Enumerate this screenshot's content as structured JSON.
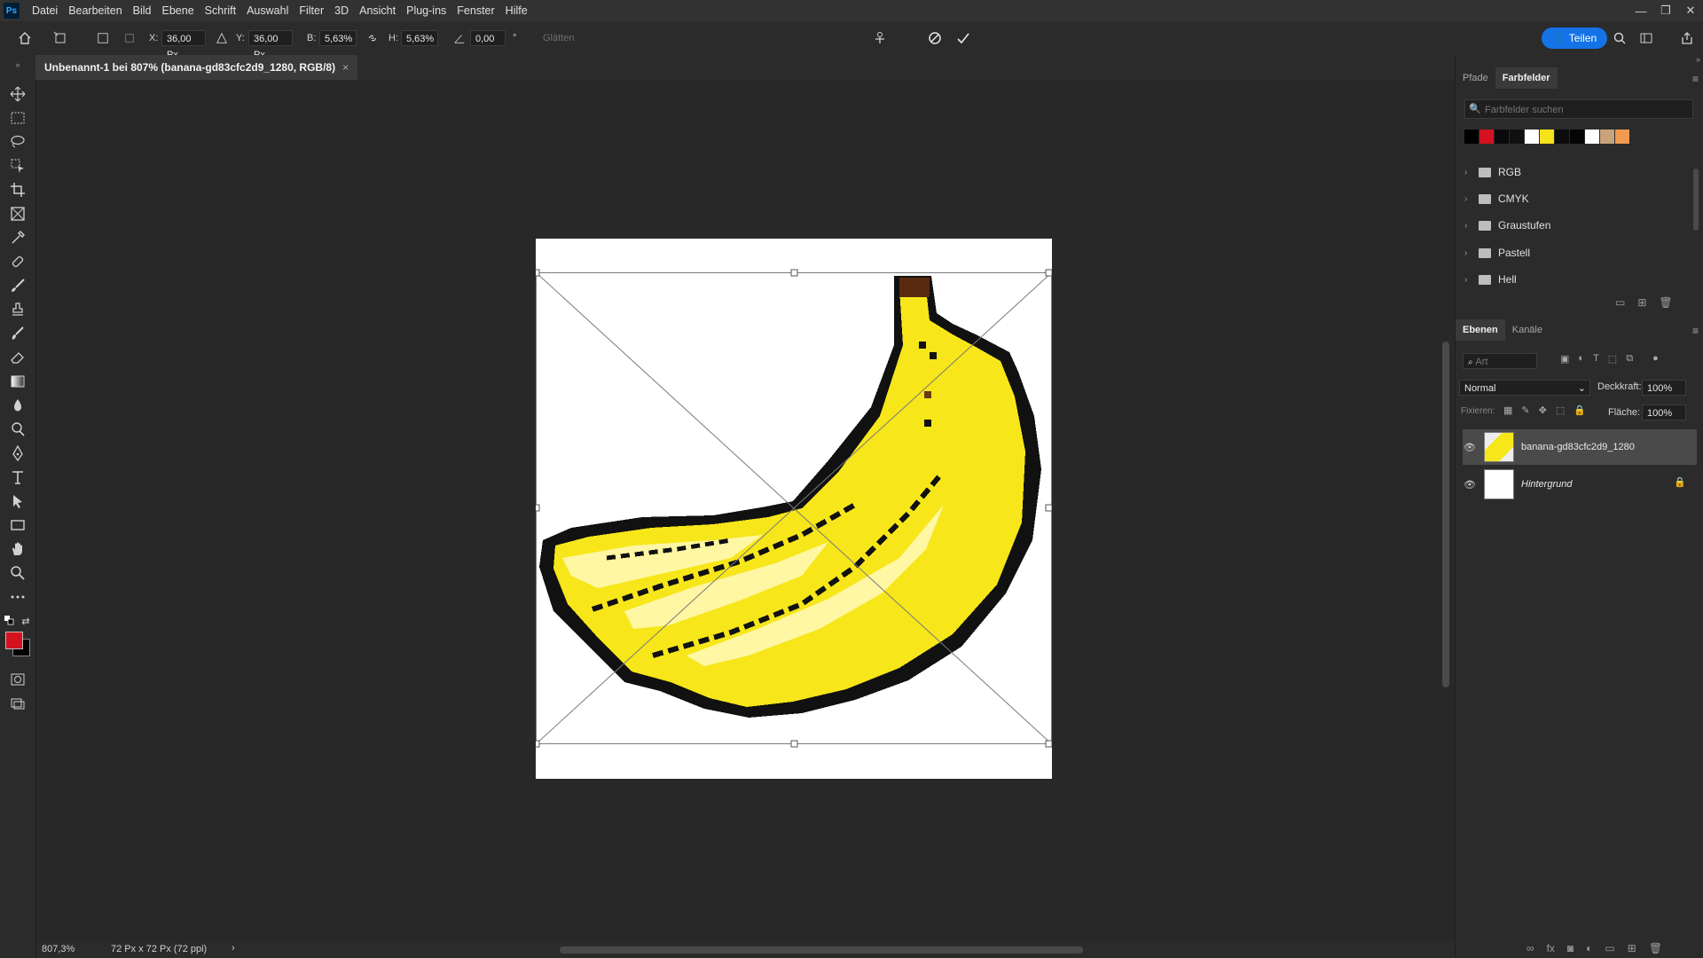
{
  "app": {
    "logo": "Ps"
  },
  "menu": [
    "Datei",
    "Bearbeiten",
    "Bild",
    "Ebene",
    "Schrift",
    "Auswahl",
    "Filter",
    "3D",
    "Ansicht",
    "Plug-ins",
    "Fenster",
    "Hilfe"
  ],
  "options": {
    "x_label": "X:",
    "x_value": "36,00 Px",
    "y_label": "Y:",
    "y_value": "36,00 Px",
    "w_label": "B:",
    "w_value": "5,63%",
    "h_label": "H:",
    "h_value": "5,63%",
    "angle_value": "0,00",
    "angle_unit": "°",
    "smooth_label": "Glätten",
    "share_label": "Teilen"
  },
  "document": {
    "tab_title": "Unbenannt-1 bei 807% (banana-gd83cfc2d9_1280, RGB/8)",
    "close": "×"
  },
  "status": {
    "zoom": "807,3%",
    "doc_info": "72 Px x 72 Px (72 ppi)",
    "arrow": "›"
  },
  "swatches_panel": {
    "tabs": [
      "Pfade",
      "Farbfelder"
    ],
    "search_placeholder": "Farbfelder suchen",
    "colors": [
      "#000000",
      "#d4121f",
      "#0a0a0a",
      "#101010",
      "#ffffff",
      "#f4e21c",
      "#0c0c0c",
      "#050505",
      "#ffffff",
      "#c9a27a",
      "#f09a52"
    ],
    "groups": [
      "RGB",
      "CMYK",
      "Graustufen",
      "Pastell",
      "Hell"
    ]
  },
  "layers_panel": {
    "tabs": [
      "Ebenen",
      "Kanäle"
    ],
    "filter_placeholder": "Art",
    "blend_mode": "Normal",
    "opacity_label": "Deckkraft:",
    "opacity_value": "100%",
    "lock_label": "Fixieren:",
    "fill_label": "Fläche:",
    "fill_value": "100%",
    "layers": [
      {
        "name": "banana-gd83cfc2d9_1280",
        "selected": true
      },
      {
        "name": "Hintergrund",
        "selected": false,
        "locked": true
      }
    ]
  },
  "colors": {
    "foreground": "#d4121f",
    "background": "#000000",
    "accent": "#1473e6"
  }
}
